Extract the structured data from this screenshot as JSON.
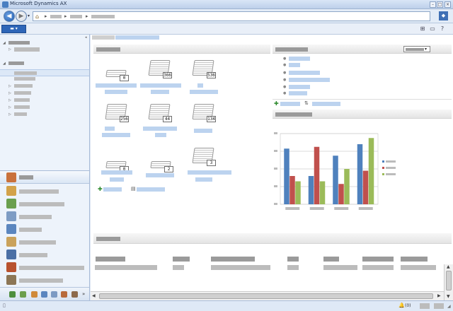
{
  "window": {
    "title": "Microsoft Dynamics AX"
  },
  "statusbar": {
    "notification_count": "(0)"
  },
  "workspace": {
    "cues": [
      {
        "count": "0"
      },
      {
        "count": "366"
      },
      {
        "count": "536"
      },
      {
        "count": "256"
      },
      {
        "count": "44"
      },
      {
        "count": "134"
      },
      {
        "count": "0"
      },
      {
        "count": "2"
      },
      {
        "count": "3"
      }
    ]
  },
  "chart_data": {
    "type": "bar",
    "title": "",
    "categories": [
      "",
      "",
      "",
      ""
    ],
    "series": [
      {
        "color": "#4f81bd",
        "values": [
          63,
          32,
          55,
          68
        ]
      },
      {
        "color": "#c0504d",
        "values": [
          32,
          65,
          23,
          38
        ]
      },
      {
        "color": "#9bbb59",
        "values": [
          26,
          26,
          40,
          75
        ]
      }
    ],
    "ylim": [
      0,
      80
    ],
    "grid": true,
    "legend": "right"
  },
  "colors": {
    "accent": "#2e66b8",
    "panel_header": "#9a9a9a"
  }
}
